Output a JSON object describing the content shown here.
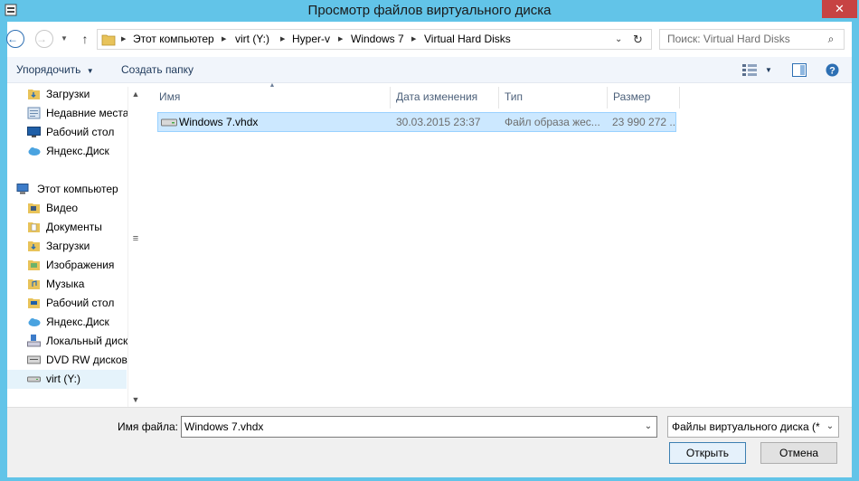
{
  "window": {
    "title": "Просмотр файлов виртуального диска",
    "close_glyph": "✕"
  },
  "address_bar": {
    "crumbs": [
      "Этот компьютер",
      "virt (Y:)",
      "Hyper-v",
      "Windows 7",
      "Virtual Hard Disks"
    ]
  },
  "search": {
    "placeholder": "Поиск: Virtual Hard Disks"
  },
  "toolbar": {
    "organize_label": "Упорядочить",
    "new_folder_label": "Создать папку"
  },
  "nav_pane": {
    "favorites": [
      {
        "label": "Загрузки",
        "icon": "downloads-icon"
      },
      {
        "label": "Недавние места",
        "icon": "recent-places-icon"
      },
      {
        "label": "Рабочий стол",
        "icon": "desktop-icon"
      },
      {
        "label": "Яндекс.Диск",
        "icon": "cloud-icon"
      }
    ],
    "computer_label": "Этот компьютер",
    "computer_items": [
      {
        "label": "Видео",
        "icon": "folder-video-icon"
      },
      {
        "label": "Документы",
        "icon": "folder-documents-icon"
      },
      {
        "label": "Загрузки",
        "icon": "folder-downloads-icon"
      },
      {
        "label": "Изображения",
        "icon": "folder-pictures-icon"
      },
      {
        "label": "Музыка",
        "icon": "folder-music-icon"
      },
      {
        "label": "Рабочий стол",
        "icon": "folder-desktop-icon"
      },
      {
        "label": "Яндекс.Диск",
        "icon": "cloud-icon"
      },
      {
        "label": "Локальный диск",
        "icon": "local-disk-icon"
      },
      {
        "label": "DVD RW дисково",
        "icon": "dvd-drive-icon"
      },
      {
        "label": "virt (Y:)",
        "icon": "drive-icon"
      }
    ]
  },
  "columns": {
    "name": "Имя",
    "date": "Дата изменения",
    "type": "Тип",
    "size": "Размер"
  },
  "files": [
    {
      "name": "Windows 7.vhdx",
      "date": "30.03.2015 23:37",
      "type": "Файл образа жес...",
      "size": "23 990 272 ..."
    }
  ],
  "footer": {
    "filename_label": "Имя файла:",
    "filename_value": "Windows 7.vhdx",
    "filter_value": "Файлы виртуального диска (*",
    "open_label": "Открыть",
    "cancel_label": "Отмена"
  }
}
